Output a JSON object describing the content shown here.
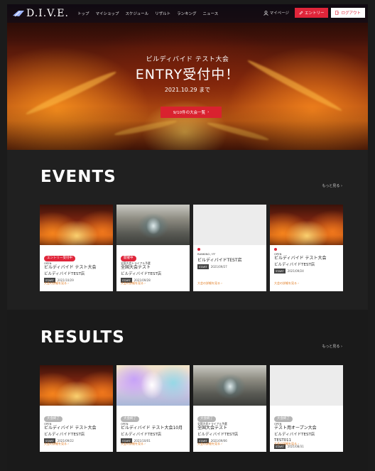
{
  "nav": {
    "logo_text": "D.I.V.E.",
    "links": [
      "トップ",
      "マイショップ",
      "スケジュール",
      "リザルト",
      "ランキング",
      "ニュース"
    ],
    "mypage": "マイページ",
    "entry": "エントリー",
    "logout": "ログアウト"
  },
  "hero": {
    "subtitle": "ビルディバイド テスト大会",
    "title": "ENTRY受付中！",
    "date": "2021.10.29 まで",
    "button": "9/10件の大会一覧"
  },
  "events": {
    "title": "EVENTS",
    "more": "もっと見る",
    "cards": [
      {
        "badge": "エントリー受付中",
        "badge_style": "red",
        "pre": "OPEN",
        "title": "ビルディバイド テスト大会",
        "org": "ビルディバイドTEST店",
        "start_label": "START",
        "start_date": "2021/10/29",
        "detail": "大会の詳細を見る"
      },
      {
        "badge": "開催中",
        "badge_style": "red",
        "pre": "全国大会トライアル予選",
        "title": "全国大会テスト",
        "org": "ビルディバイドTEST店",
        "start_label": "START",
        "start_date": "2021/09/28",
        "detail": "大会の詳細を見る"
      },
      {
        "badge": "",
        "badge_style": "dot",
        "pre": "RANKING / FF",
        "title": "ビルディバイドTEST店",
        "org": "",
        "start_label": "START",
        "start_date": "2021/09/27",
        "detail": "大会の詳細を見る"
      },
      {
        "badge": "",
        "badge_style": "dot",
        "pre": "OPEN",
        "title": "ビルディバイド テスト大会",
        "org": "ビルディバイドTEST店",
        "start_label": "START",
        "start_date": "2021/09/24",
        "detail": "大会の詳細を見る"
      }
    ]
  },
  "results": {
    "title": "RESULTS",
    "more": "もっと見る",
    "cards": [
      {
        "badge": "大会終了",
        "badge_style": "gray",
        "pre": "OPEN",
        "title": "ビルディバイド テスト大会",
        "org": "ビルディバイドTEST店",
        "start_label": "START",
        "start_date": "2021/09/22",
        "detail": "大会の詳細を見る"
      },
      {
        "badge": "大会終了",
        "badge_style": "gray",
        "pre": "OPEN",
        "title": "ビルディバイド テスト大会10月",
        "org": "ビルディバイドTEST店",
        "start_label": "START",
        "start_date": "2021/10/01",
        "detail": "大会の詳細を見る"
      },
      {
        "badge": "大会終了",
        "badge_style": "gray",
        "pre": "全国大会トライアル予選",
        "title": "全国大会テスト",
        "org": "ビルディバイドTEST店",
        "start_label": "START",
        "start_date": "2021/09/06",
        "detail": "大会の詳細を見る"
      },
      {
        "badge": "大会終了",
        "badge_style": "gray",
        "pre": "OPEN",
        "title": "テスト用オープン大会",
        "org": "ビルディバイドTEST店",
        "org2": "TEST011",
        "start_label": "START",
        "start_date": "2021/08/31",
        "detail": "大会の詳細を見る"
      }
    ]
  },
  "colors": {
    "accent": "#e0253a",
    "link": "#e07a20",
    "dark_bg": "#202020"
  },
  "icons": {
    "logo": "dive-logo-icon",
    "user": "user-icon",
    "entry": "pencil-icon",
    "logout": "logout-icon",
    "arrow": "chevron-right-icon"
  }
}
